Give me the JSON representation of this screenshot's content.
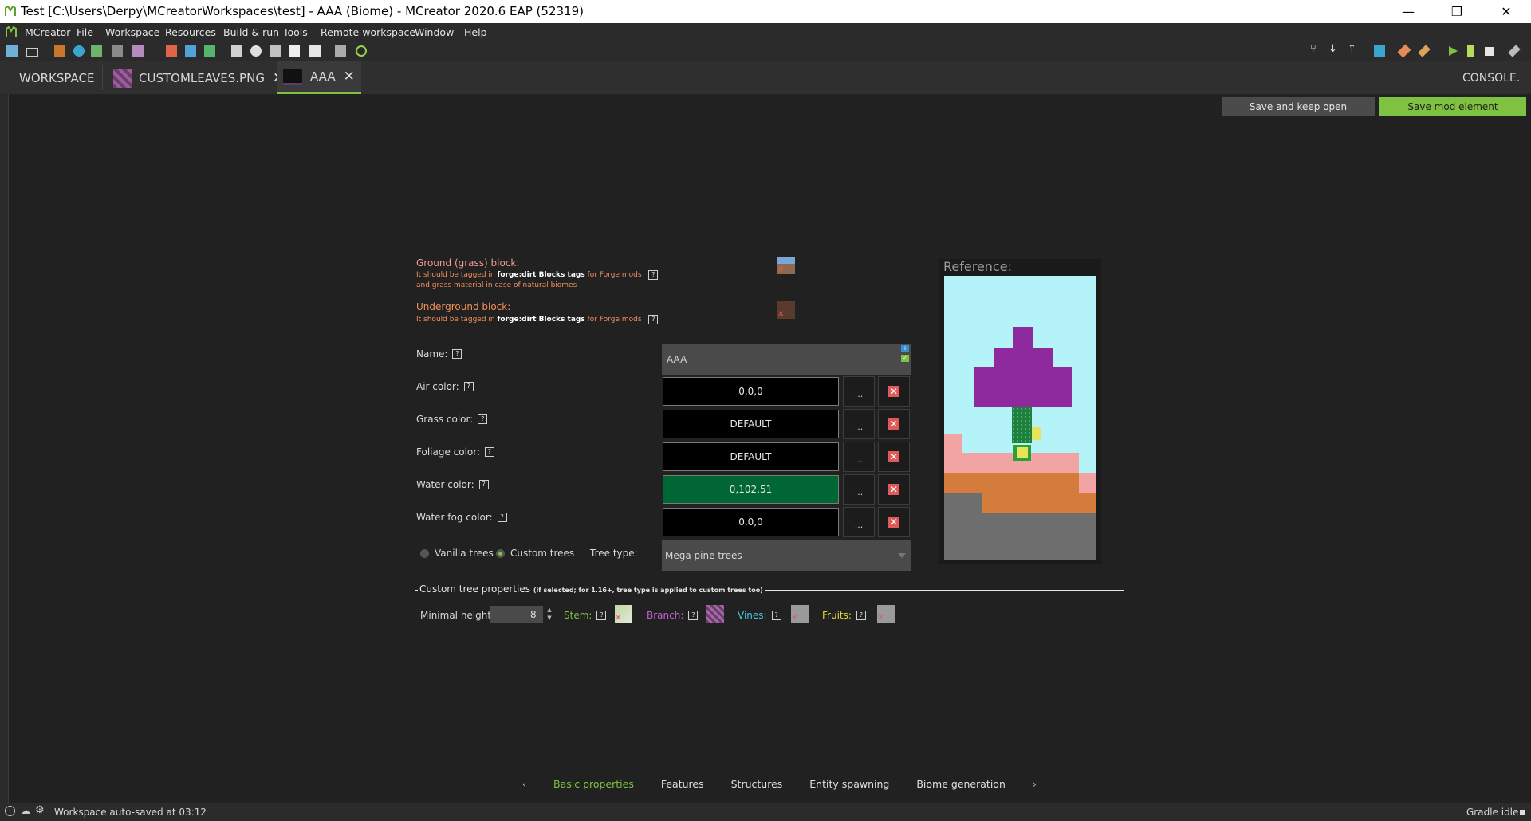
{
  "window": {
    "title": "Test [C:\\Users\\Derpy\\MCreatorWorkspaces\\test] - AAA (Biome) - MCreator 2020.6 EAP (52319)"
  },
  "menu": [
    "MCreator",
    "File",
    "Workspace",
    "Resources",
    "Build & run",
    "Tools",
    "Remote workspace",
    "Window",
    "Help"
  ],
  "tabs": [
    {
      "label": "WORKSPACE"
    },
    {
      "label": "CUSTOMLEAVES.PNG"
    },
    {
      "label": "AAA"
    }
  ],
  "console_label": "CONSOLE.",
  "actions": {
    "save_keep_open": "Save and keep open",
    "save_element": "Save mod element"
  },
  "form": {
    "ground": {
      "label": "Ground (grass) block:",
      "hint_a": "It should be tagged in",
      "hint_b": "forge:dirt Blocks tags",
      "hint_c": "for Forge mods",
      "hint_d": "and grass material in case of natural biomes"
    },
    "underground": {
      "label": "Underground block:",
      "hint_a": "It should be tagged in",
      "hint_b": "forge:dirt Blocks tags",
      "hint_c": "for Forge mods"
    },
    "name": {
      "label": "Name:",
      "value": "AAA"
    },
    "colors": [
      {
        "label": "Air color:",
        "value": "0,0,0",
        "bg": "#000000"
      },
      {
        "label": "Grass color:",
        "value": "DEFAULT",
        "bg": "#000000"
      },
      {
        "label": "Foliage color:",
        "value": "DEFAULT",
        "bg": "#000000"
      },
      {
        "label": "Water color:",
        "value": "0,102,51",
        "bg": "#006633"
      },
      {
        "label": "Water fog color:",
        "value": "0,0,0",
        "bg": "#000000"
      }
    ],
    "dots_label": "...",
    "vanilla_trees": "Vanilla trees",
    "custom_trees": "Custom trees",
    "tree_type_label": "Tree type:",
    "tree_type_value": "Mega pine trees",
    "reference_label": "Reference:",
    "custom_tree": {
      "legend_main": "Custom tree properties",
      "legend_note": "(if selected; for 1.16+, tree type is applied to custom trees too)",
      "min_height_label": "Minimal height:",
      "min_height_value": "8",
      "stem": "Stem:",
      "branch": "Branch:",
      "vines": "Vines:",
      "fruits": "Fruits:"
    }
  },
  "wizard": {
    "steps": [
      "Basic properties",
      "Features",
      "Structures",
      "Entity spawning",
      "Biome generation"
    ],
    "active": "Basic properties"
  },
  "status": {
    "left": "Workspace auto-saved at 03:12",
    "right": "Gradle idle"
  },
  "theme": {
    "accent": "#7fc241",
    "label_orange": "#f28f5a",
    "label_salmon": "#f39b8e",
    "stem_green": "#7fc241",
    "branch_purple": "#c660d6",
    "vines_cyan": "#49c6e5",
    "fruits_yellow": "#e6d23a"
  }
}
